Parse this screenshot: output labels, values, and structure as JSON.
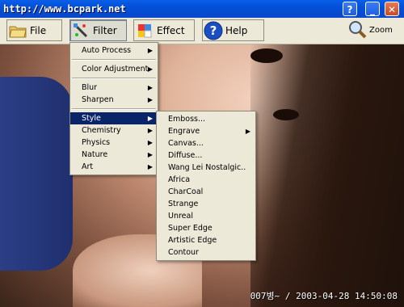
{
  "window": {
    "title": "http://www.bcpark.net",
    "help_glyph": "?",
    "minimize_glyph": "_",
    "close_glyph": "✕"
  },
  "toolbar": {
    "file_label": "File",
    "filter_label": "Filter",
    "effect_label": "Effect",
    "help_label": "Help",
    "zoom_label": "Zoom"
  },
  "filter_menu": {
    "items": [
      {
        "label": "Auto Process"
      },
      {
        "label": "Color Adjustment"
      },
      {
        "label": "Blur"
      },
      {
        "label": "Sharpen"
      },
      {
        "label": "Style"
      },
      {
        "label": "Chemistry"
      },
      {
        "label": "Physics"
      },
      {
        "label": "Nature"
      },
      {
        "label": "Art"
      }
    ],
    "arrow_glyph": "▶"
  },
  "style_submenu": {
    "items": [
      {
        "label": "Emboss..."
      },
      {
        "label": "Engrave"
      },
      {
        "label": "Canvas..."
      },
      {
        "label": "Diffuse..."
      },
      {
        "label": "Wang Lei Nostalgic.."
      },
      {
        "label": "Africa"
      },
      {
        "label": "CharCoal"
      },
      {
        "label": "Strange"
      },
      {
        "label": "Unreal"
      },
      {
        "label": "Super Edge"
      },
      {
        "label": "Artistic Edge"
      },
      {
        "label": "Contour"
      }
    ]
  },
  "status": {
    "text": "007병~ / 2003-04-28 14:50:08"
  },
  "colors": {
    "titlebar": "#0350d8",
    "highlight": "#0a246a",
    "menu_bg": "#ece9d8"
  }
}
